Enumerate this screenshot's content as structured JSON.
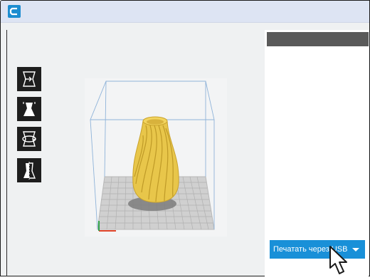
{
  "window": {
    "app_logo_icon": "cura-logo-icon"
  },
  "toolbar": {
    "tools": [
      {
        "name": "move-tool",
        "icon": "move-icon"
      },
      {
        "name": "scale-tool",
        "icon": "scale-icon"
      },
      {
        "name": "rotate-tool",
        "icon": "rotate-icon"
      },
      {
        "name": "mirror-tool",
        "icon": "mirror-icon"
      }
    ]
  },
  "viewport": {
    "model": "twisted-vase",
    "model_color": "#e8c64a",
    "build_plate_color": "#d3d3d3",
    "build_volume_color": "#8fb3d9"
  },
  "side_panel": {
    "header_color": "#5a5a5a"
  },
  "print_button": {
    "label": "Печатать через USB",
    "color": "#1990d8"
  }
}
